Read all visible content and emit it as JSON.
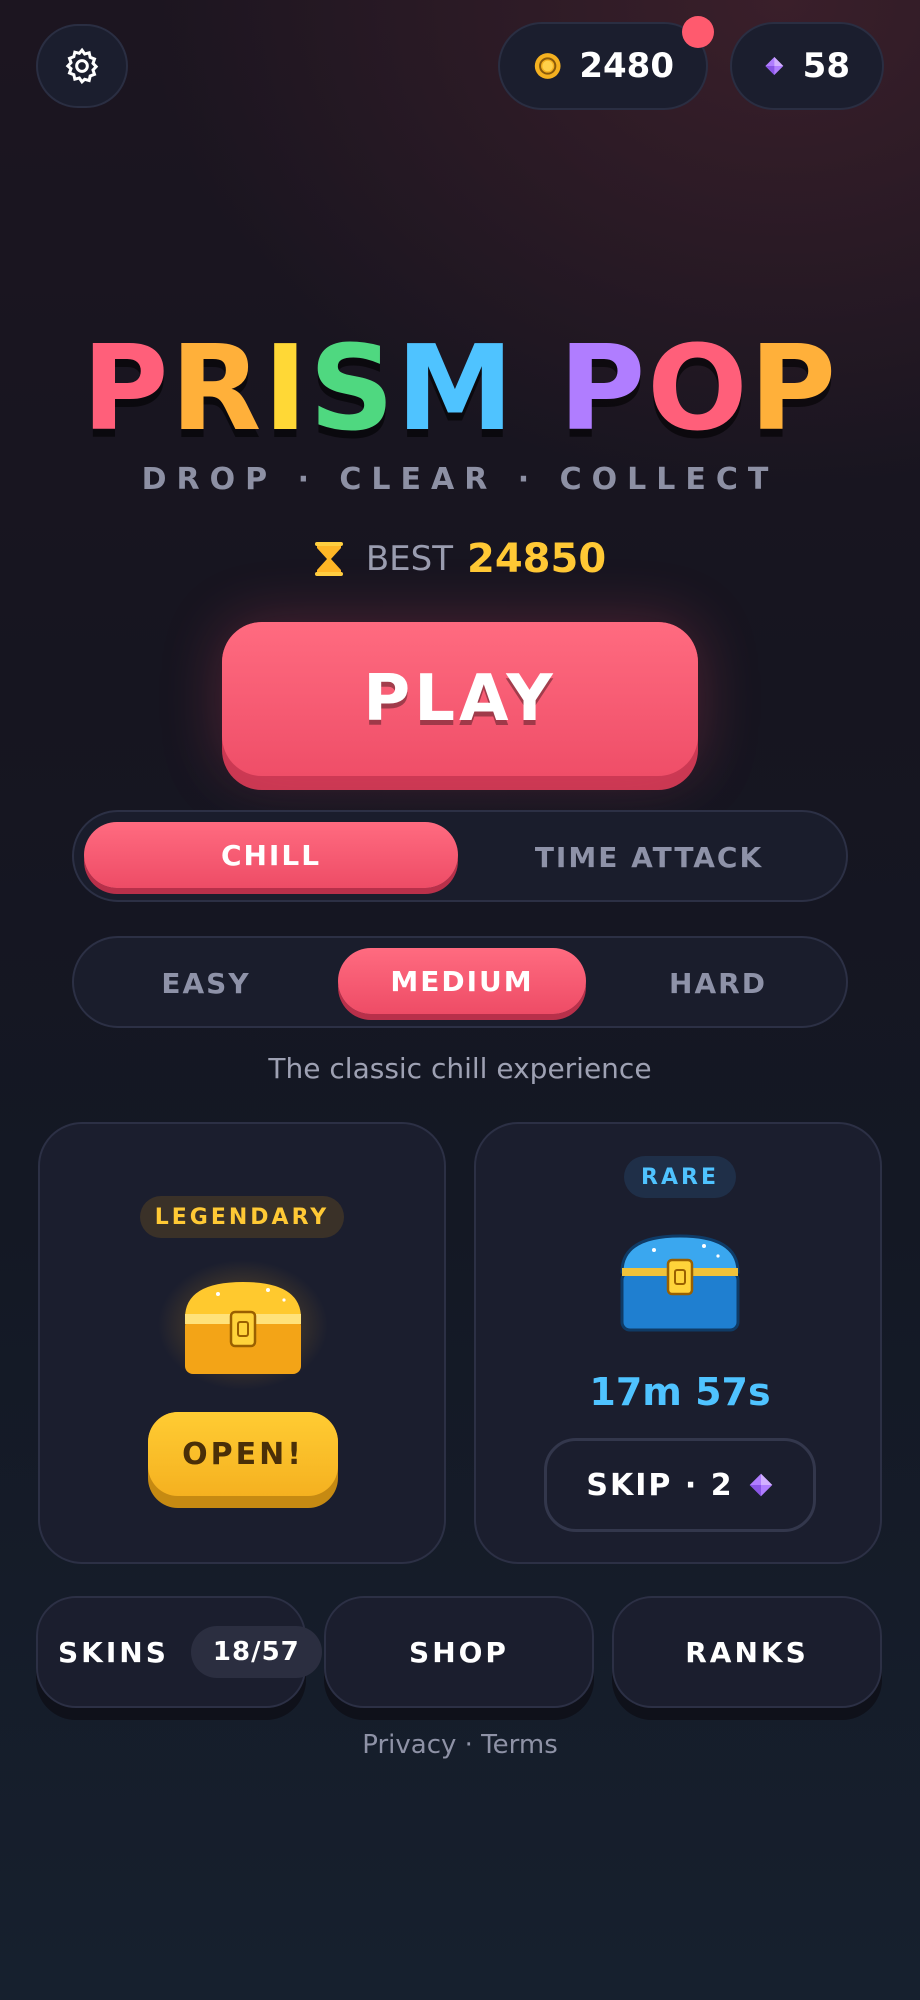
{
  "header": {
    "coins": "2480",
    "gems": "58"
  },
  "game": {
    "title_letters": [
      {
        "ch": "P",
        "color": "#ff5f7a"
      },
      {
        "ch": "R",
        "color": "#ffb03a"
      },
      {
        "ch": "I",
        "color": "#ffd836"
      },
      {
        "ch": "S",
        "color": "#4fd880"
      },
      {
        "ch": "M",
        "color": "#4fc3ff"
      },
      {
        "ch": " ",
        "color": "#ffffff"
      },
      {
        "ch": "P",
        "color": "#b07dff"
      },
      {
        "ch": "O",
        "color": "#ff5f7a"
      },
      {
        "ch": "P",
        "color": "#ffb03a"
      }
    ],
    "subtitle": "DROP · CLEAR · COLLECT",
    "best_label": "BEST",
    "best_score": "24850",
    "play_label": "PLAY"
  },
  "modes": {
    "selected": "CHILL",
    "options": [
      "CHILL",
      "TIME ATTACK"
    ]
  },
  "difficulty": {
    "selected": "MEDIUM",
    "options": [
      "EASY",
      "MEDIUM",
      "HARD"
    ]
  },
  "mode_description": "The classic chill experience",
  "chests": {
    "legendary": {
      "rarity": "LEGENDARY",
      "action": "OPEN!"
    },
    "rare": {
      "rarity": "RARE",
      "timer": "17m 57s",
      "skip_label": "SKIP · 2"
    }
  },
  "nav": {
    "skins_label": "SKINS",
    "skins_count": "18/57",
    "shop_label": "SHOP",
    "ranks_label": "RANKS"
  },
  "footer": {
    "privacy": "Privacy",
    "separator": "·",
    "terms": "Terms"
  },
  "colors": {
    "accent": "#ef4e68",
    "gold": "#ffc935",
    "rare_blue": "#4fc3ff",
    "gem_purple": "#b07dff"
  }
}
